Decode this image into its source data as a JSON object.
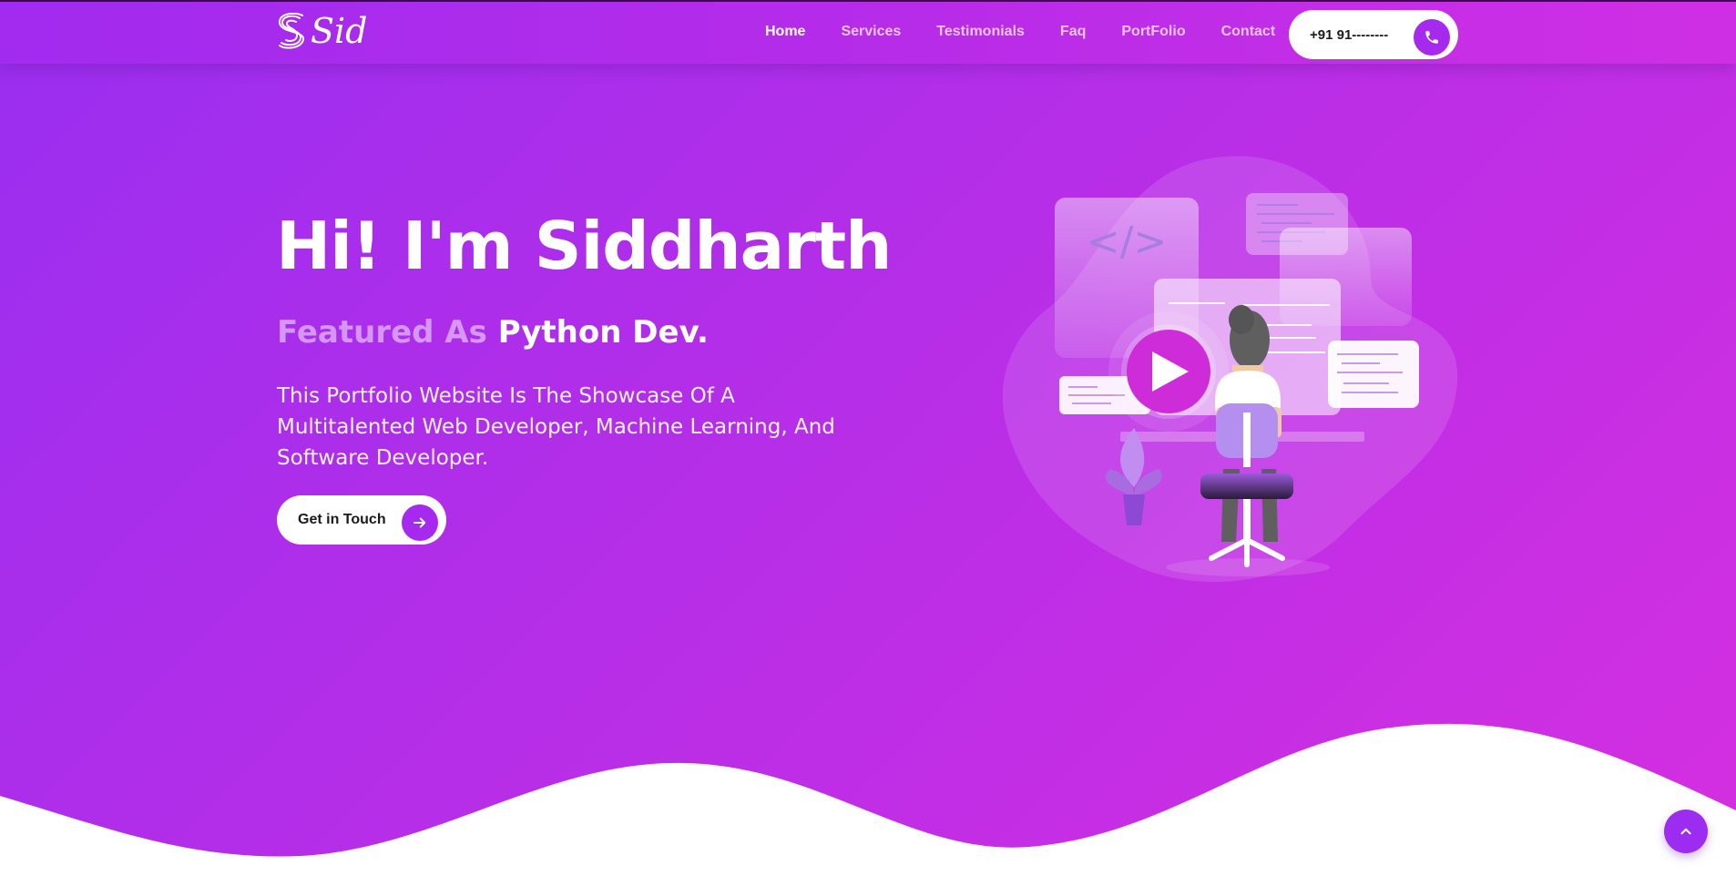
{
  "brand": {
    "logo_text": "Sid"
  },
  "nav": {
    "items": [
      {
        "label": "Home",
        "active": true
      },
      {
        "label": "Services",
        "active": false
      },
      {
        "label": "Testimonials",
        "active": false
      },
      {
        "label": "Faq",
        "active": false
      },
      {
        "label": "PortFolio",
        "active": false
      },
      {
        "label": "Contact",
        "active": false
      }
    ],
    "phone": "+91 91--------"
  },
  "hero": {
    "title": "Hi! I'm Siddharth",
    "subtitle_prefix": "Featured As",
    "subtitle_role": "Python Dev.",
    "description": "This Portfolio Website Is The Showcase Of A Multitalented Web Developer, Machine Learning, And Software Developer.",
    "cta_label": "Get in Touch"
  },
  "illustration": {
    "code_symbol": "</>"
  },
  "colors": {
    "gradient_start": "#9a2ef0",
    "gradient_end": "#d42fe0",
    "accent": "#a52aee",
    "white": "#ffffff"
  },
  "icons": {
    "phone": "phone-icon",
    "arrow": "arrow-right-icon",
    "scroll_top": "chevron-up-icon",
    "play": "play-icon"
  }
}
